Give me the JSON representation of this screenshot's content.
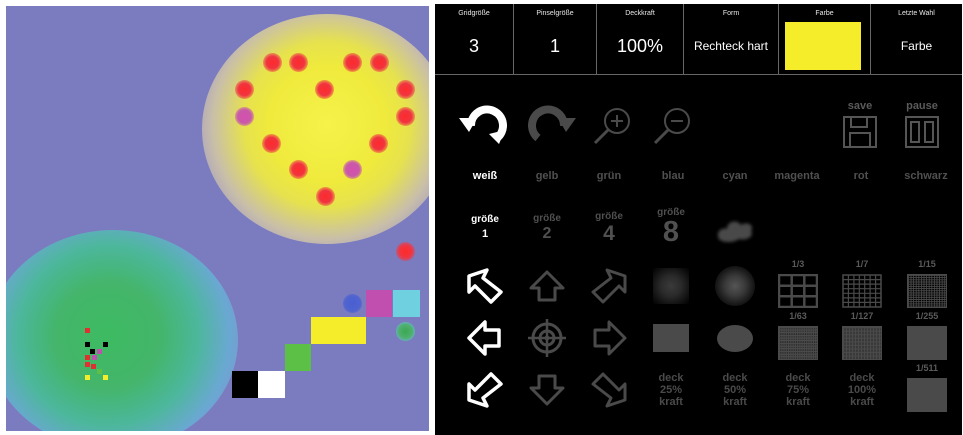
{
  "toolbar": {
    "grid_label": "Gridgröße",
    "grid_value": "3",
    "brush_label": "Pinselgröße",
    "brush_value": "1",
    "opacity_label": "Deckkraft",
    "opacity_value": "100%",
    "shape_label": "Form",
    "shape_value": "Rechteck hart",
    "color_label": "Farbe",
    "color_value": "#f5ec2a",
    "last_label": "Letzte Wahl",
    "last_value": "Farbe"
  },
  "actions": {
    "save_label": "save",
    "pause_label": "pause"
  },
  "colors": [
    {
      "label": "weiß",
      "hex": "#ffffff"
    },
    {
      "label": "gelb",
      "hex": "#ffff00"
    },
    {
      "label": "grün",
      "hex": "#00ff00"
    },
    {
      "label": "blau",
      "hex": "#0000ff"
    },
    {
      "label": "cyan",
      "hex": "#00ffff"
    },
    {
      "label": "magenta",
      "hex": "#ff00ff"
    },
    {
      "label": "rot",
      "hex": "#ff0000"
    },
    {
      "label": "schwarz",
      "hex": "#000000"
    }
  ],
  "sizes": {
    "label": "größe",
    "values": [
      "1",
      "2",
      "4",
      "8"
    ]
  },
  "grids": [
    "1/3",
    "1/7",
    "1/15",
    "1/63",
    "1/127",
    "1/255",
    "1/511"
  ],
  "opacity_buttons": [
    {
      "line1": "deck",
      "line2": "25%",
      "line3": "kraft"
    },
    {
      "line1": "deck",
      "line2": "50%",
      "line3": "kraft"
    },
    {
      "line1": "deck",
      "line2": "75%",
      "line3": "kraft"
    },
    {
      "line1": "deck",
      "line2": "100%",
      "line3": "kraft"
    }
  ],
  "canvas_colors": {
    "background": "#7b7bc0",
    "yellow": "#f5ec2a",
    "green": "#5cbf46",
    "magenta": "#c04fb0",
    "cyan": "#6fd0e0",
    "blue": "#4a5fd0",
    "red": "#f03440"
  }
}
